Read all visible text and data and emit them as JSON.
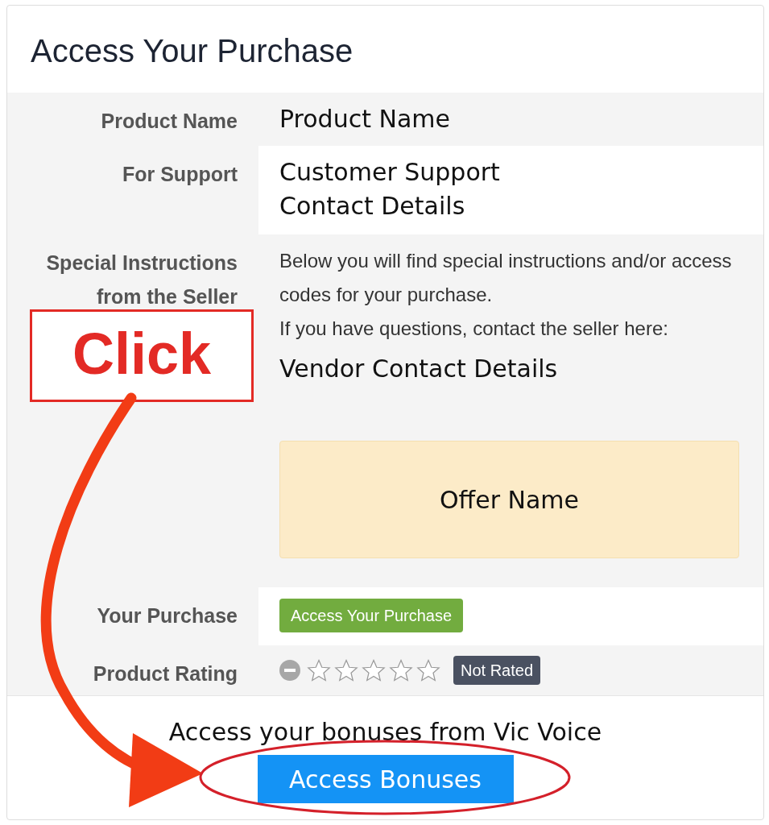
{
  "card": {
    "title": "Access Your Purchase"
  },
  "rows": [
    {
      "label": "Product Name",
      "kind": "text",
      "value": "Product Name"
    },
    {
      "label": "For Support",
      "kind": "text",
      "value": "Customer Support\nContact Details"
    },
    {
      "label": "Special Instructions from the Seller",
      "kind": "instructions",
      "paragraphs": [
        "Below you will find special instructions and/or access codes for your purchase.",
        "If you have questions, contact the seller here:"
      ],
      "contact": "Vendor Contact Details",
      "offer": "Offer Name"
    },
    {
      "label": "Your Purchase",
      "kind": "button",
      "button": "Access Your Purchase"
    },
    {
      "label": "Product Rating",
      "kind": "rating",
      "stars": 0,
      "badge": "Not Rated"
    }
  ],
  "footer": {
    "text": "Access your bonuses from Vic Voice",
    "button": "Access Bonuses"
  },
  "annotation": {
    "callout": "Click"
  }
}
